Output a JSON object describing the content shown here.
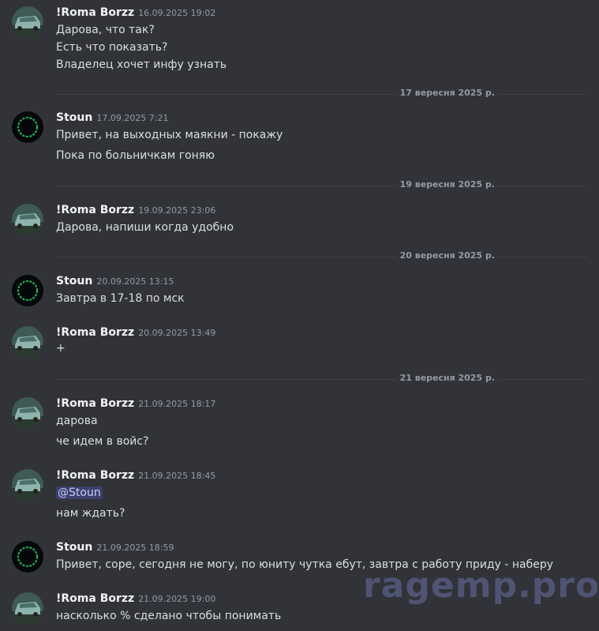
{
  "users": {
    "roma": "!Roma Borzz",
    "stoun": "Stoun"
  },
  "dividers": [
    "17 вересня 2025 р.",
    "19 вересня 2025 р.",
    "20 вересня 2025 р.",
    "21 вересня 2025 р."
  ],
  "messages": [
    {
      "author": "!Roma Borzz",
      "time": "16.09.2025 19:02",
      "lines": [
        "Дарова, что так?",
        "Есть что показать?",
        "Владелец хочет инфу узнать"
      ]
    },
    {
      "author": "Stoun",
      "time": "17.09.2025 7:21",
      "lines": [
        "Привет, на выходных маякни - покажу",
        "Пока по больничкам гоняю"
      ]
    },
    {
      "author": "!Roma Borzz",
      "time": "19.09.2025 23:06",
      "lines": [
        "Дарова, напиши когда удобно"
      ]
    },
    {
      "author": "Stoun",
      "time": "20.09.2025 13:15",
      "lines": [
        "Завтра в 17-18 по мск"
      ]
    },
    {
      "author": "!Roma Borzz",
      "time": "20.09.2025 13:49",
      "lines": [
        "+"
      ]
    },
    {
      "author": "!Roma Borzz",
      "time": "21.09.2025 18:17",
      "lines": [
        "дарова",
        "че идем в войс?"
      ]
    },
    {
      "author": "!Roma Borzz",
      "time": "21.09.2025 18:45",
      "lines": [
        "@Stoun",
        "нам ждать?"
      ]
    },
    {
      "author": "Stoun",
      "time": "21.09.2025 18:59",
      "lines": [
        "Привет, соре, сегодня не могу, по юниту чутка ебут, завтра с работу приду - наберу"
      ]
    },
    {
      "author": "!Roma Borzz",
      "time": "21.09.2025 19:00",
      "lines": [
        "насколько % сделано чтобы понимать"
      ]
    }
  ],
  "watermark": "ragemp.pro",
  "colors": {
    "background": "#313338",
    "text": "#dbdee1",
    "author": "#f2f3f5",
    "muted": "#949ba4",
    "mention_bg": "#3c4270",
    "ring": "#1fbf5f"
  },
  "icons": {
    "roma_avatar": "car-photo-avatar",
    "stoun_avatar": "green-ring-avatar"
  }
}
